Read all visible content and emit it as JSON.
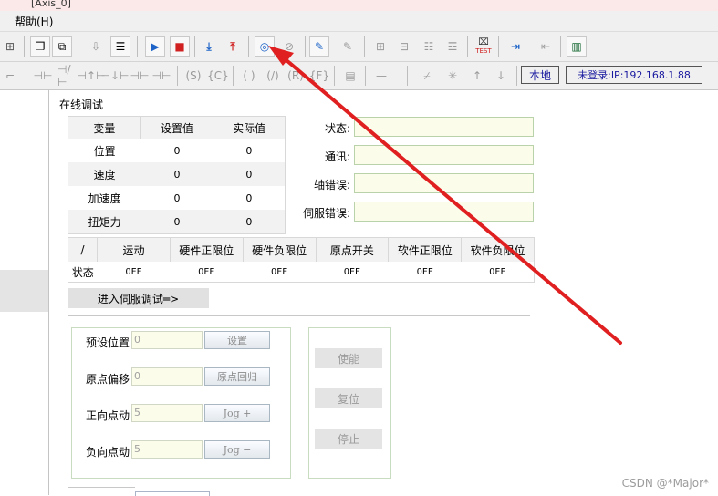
{
  "window": {
    "title_fragment": "[Axis_0]"
  },
  "menu": {
    "help": "帮助(H)"
  },
  "toolbar": {
    "mode_local": "本地",
    "login_status": "未登录:IP:192.168.1.88",
    "test_label": "TEST"
  },
  "panel": {
    "title": "在线调试",
    "var_table": {
      "headers": [
        "变量",
        "设置值",
        "实际值"
      ],
      "rows": [
        {
          "name": "位置",
          "set": "0",
          "actual": "0"
        },
        {
          "name": "速度",
          "set": "0",
          "actual": "0"
        },
        {
          "name": "加速度",
          "set": "0",
          "actual": "0"
        },
        {
          "name": "扭矩力",
          "set": "0",
          "actual": "0"
        }
      ]
    },
    "status_fields": [
      "状态:",
      "通讯:",
      "轴错误:",
      "伺服错误:"
    ],
    "io_table": {
      "headers": [
        "/",
        "运动",
        "硬件正限位",
        "硬件负限位",
        "原点开关",
        "软件正限位",
        "软件负限位"
      ],
      "row_label": "状态",
      "values": [
        "OFF",
        "OFF",
        "OFF",
        "OFF",
        "OFF",
        "OFF"
      ]
    },
    "servo_debug_button": "进入伺服调试═>",
    "controls": [
      {
        "label": "预设位置",
        "value": "0",
        "button": "设置"
      },
      {
        "label": "原点偏移",
        "value": "0",
        "button": "原点回归"
      },
      {
        "label": "正向点动",
        "value": "5",
        "button": "Jog +"
      },
      {
        "label": "负向点动",
        "value": "5",
        "button": "Jog −"
      }
    ],
    "side_buttons": [
      "使能",
      "复位",
      "停止"
    ]
  },
  "watermark": "CSDN @*Major*",
  "colors": {
    "arrow": "#e02020",
    "field_bg": "#fcfcea",
    "badge_text": "#1a1aa0"
  }
}
